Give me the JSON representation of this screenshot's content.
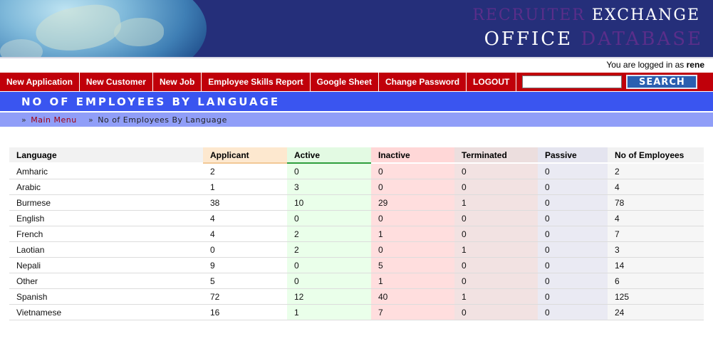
{
  "brand": {
    "line1_dim": "RECRUITER",
    "line1_bright": "EXCHANGE",
    "line2_bright": "OFFICE",
    "line2_dim": "DATABASE"
  },
  "login": {
    "prefix": "You are logged in as",
    "user": "rene"
  },
  "nav": {
    "items": [
      "New Application",
      "New Customer",
      "New Job",
      "Employee Skills Report",
      "Google Sheet",
      "Change Password",
      "LOGOUT"
    ],
    "search_value": "",
    "search_button": "SEARCH"
  },
  "page": {
    "title": "NO OF EMPLOYEES BY LANGUAGE",
    "breadcrumb": {
      "sep": "»",
      "main_menu": "Main Menu",
      "current": "No of Employees By Language"
    }
  },
  "table": {
    "headers": [
      "Language",
      "Applicant",
      "Active",
      "Inactive",
      "Terminated",
      "Passive",
      "No of Employees"
    ],
    "rows": [
      [
        "Amharic",
        "2",
        "0",
        "0",
        "0",
        "0",
        "2"
      ],
      [
        "Arabic",
        "1",
        "3",
        "0",
        "0",
        "0",
        "4"
      ],
      [
        "Burmese",
        "38",
        "10",
        "29",
        "1",
        "0",
        "78"
      ],
      [
        "English",
        "4",
        "0",
        "0",
        "0",
        "0",
        "4"
      ],
      [
        "French",
        "4",
        "2",
        "1",
        "0",
        "0",
        "7"
      ],
      [
        "Laotian",
        "0",
        "2",
        "0",
        "1",
        "0",
        "3"
      ],
      [
        "Nepali",
        "9",
        "0",
        "5",
        "0",
        "0",
        "14"
      ],
      [
        "Other",
        "5",
        "0",
        "1",
        "0",
        "0",
        "6"
      ],
      [
        "Spanish",
        "72",
        "12",
        "40",
        "1",
        "0",
        "125"
      ],
      [
        "Vietnamese",
        "16",
        "1",
        "7",
        "0",
        "0",
        "24"
      ]
    ]
  },
  "colors": {
    "nav_bg": "#c0000a",
    "title_bg": "#3a55f0",
    "breadcrumb_bg": "#909ef8",
    "banner_bg": "#252f7a"
  }
}
